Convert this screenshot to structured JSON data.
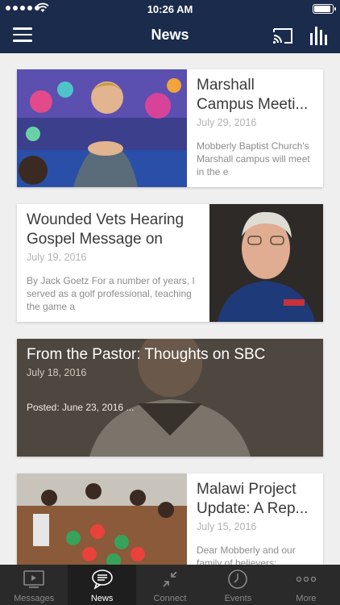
{
  "status_bar": {
    "time": "10:26 AM"
  },
  "nav": {
    "title": "News"
  },
  "articles": [
    {
      "title": "Marshall Campus Meeti...",
      "date": "July 29, 2016",
      "excerpt": "Mobberly Baptist Church's Marshall campus will meet in the e"
    },
    {
      "title": "Wounded Vets Hearing Gospel Message on Go...",
      "date": "July 19, 2016",
      "excerpt": "By Jack Goetz For a number of years, I served as a golf professional, teaching the game a"
    },
    {
      "title": "From the Pastor: Thoughts on SBC",
      "date": "July 18, 2016",
      "excerpt": "Posted: June 23, 2016 ..."
    },
    {
      "title": "Malawi Project Update: A Rep...",
      "date": "July 15, 2016",
      "excerpt": "Dear Mobberly and our family of believers:"
    }
  ],
  "tabs": [
    {
      "label": "Messages",
      "icon": "tv-icon"
    },
    {
      "label": "News",
      "icon": "chat-bubble-icon"
    },
    {
      "label": "Connect",
      "icon": "connect-arrows-icon"
    },
    {
      "label": "Events",
      "icon": "clock-icon"
    },
    {
      "label": "More",
      "icon": "more-dots-icon"
    }
  ],
  "colors": {
    "nav_bg": "#1b2b4b",
    "tab_bar_bg": "#2a2a2a",
    "page_bg": "#efefef"
  }
}
